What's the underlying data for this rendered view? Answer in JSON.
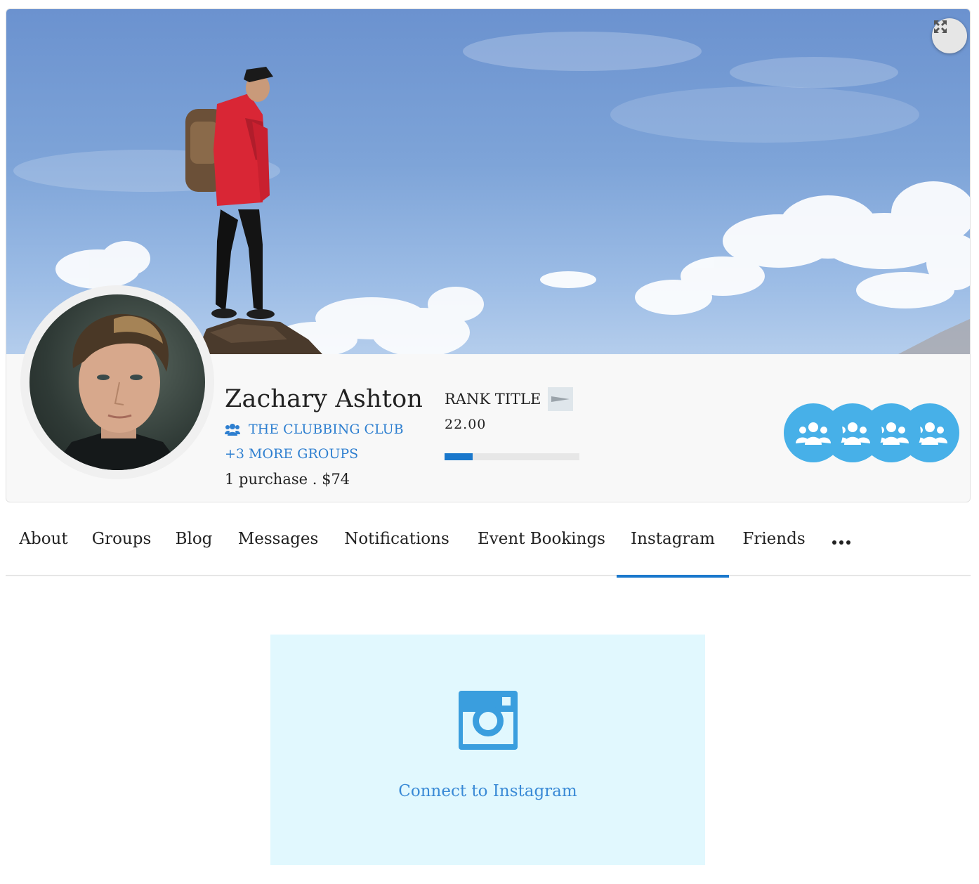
{
  "profile": {
    "name": "Zachary Ashton",
    "primary_group": "THE CLUBBING CLUB",
    "more_groups": "+3 MORE GROUPS",
    "purchase_summary": "1 purchase . $74",
    "rank": {
      "title": "RANK TITLE",
      "value": "22.00",
      "progress_fraction": 0.21
    },
    "group_avatar_count": 4
  },
  "tabs": [
    {
      "label": "About",
      "active": false
    },
    {
      "label": "Groups",
      "active": false
    },
    {
      "label": "Blog",
      "active": false
    },
    {
      "label": "Messages",
      "active": false
    },
    {
      "label": "Notifications",
      "active": false
    },
    {
      "label": "Event Bookings",
      "active": false
    },
    {
      "label": "Instagram",
      "active": true
    },
    {
      "label": "Friends",
      "active": false
    }
  ],
  "instagram": {
    "connect_label": "Connect to Instagram"
  },
  "icons": {
    "expand": "expand-arrows-icon",
    "group": "users-icon",
    "rank_badge": "pennant-icon",
    "more_tabs": "ellipsis-icon",
    "instagram": "instagram-icon"
  },
  "colors": {
    "accent": "#1a78cc",
    "link": "#2e7fd0",
    "group_circle": "#47b0e8",
    "instagram_panel_bg": "#e1f8fe",
    "instagram_icon": "#3a9ede"
  }
}
